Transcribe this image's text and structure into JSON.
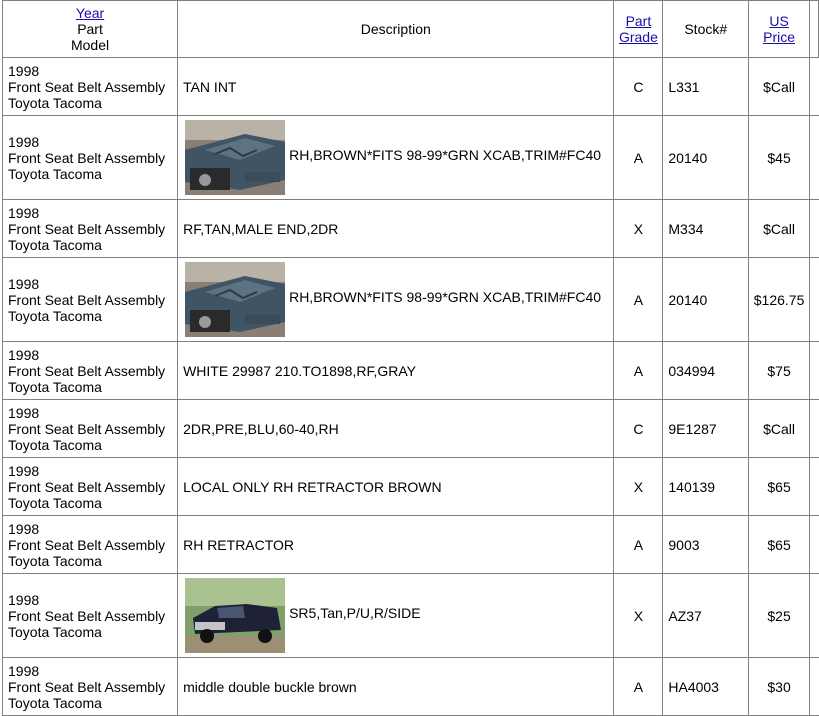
{
  "header": {
    "year_link": "Year",
    "part_label": "Part",
    "model_label": "Model",
    "description": "Description",
    "grade_link_1": "Part",
    "grade_link_2": "Grade",
    "stock": "Stock#",
    "price_link_1": "US",
    "price_link_2": "Price"
  },
  "rows": [
    {
      "year": "1998",
      "part": "Front Seat Belt Assembly",
      "model": "Toyota Tacoma",
      "description": "TAN INT",
      "image": "",
      "grade": "C",
      "stock": "L331",
      "price": "$Call"
    },
    {
      "year": "1998",
      "part": "Front Seat Belt Assembly",
      "model": "Toyota Tacoma",
      "description": "RH,BROWN*FITS 98-99*GRN XCAB,TRIM#FC40",
      "image": "damaged-truck-photo",
      "grade": "A",
      "stock": "20140",
      "price": "$45"
    },
    {
      "year": "1998",
      "part": "Front Seat Belt Assembly",
      "model": "Toyota Tacoma",
      "description": "RF,TAN,MALE END,2DR",
      "image": "",
      "grade": "X",
      "stock": "M334",
      "price": "$Call"
    },
    {
      "year": "1998",
      "part": "Front Seat Belt Assembly",
      "model": "Toyota Tacoma",
      "description": "RH,BROWN*FITS 98-99*GRN XCAB,TRIM#FC40",
      "image": "damaged-truck-photo",
      "grade": "A",
      "stock": "20140",
      "price": "$126.75"
    },
    {
      "year": "1998",
      "part": "Front Seat Belt Assembly",
      "model": "Toyota Tacoma",
      "description": "WHITE 29987 210.TO1898,RF,GRAY",
      "image": "",
      "grade": "A",
      "stock": "034994",
      "price": "$75"
    },
    {
      "year": "1998",
      "part": "Front Seat Belt Assembly",
      "model": "Toyota Tacoma",
      "description": "2DR,PRE,BLU,60-40,RH",
      "image": "",
      "grade": "C",
      "stock": "9E1287",
      "price": "$Call"
    },
    {
      "year": "1998",
      "part": "Front Seat Belt Assembly",
      "model": "Toyota Tacoma",
      "description": "LOCAL ONLY RH RETRACTOR BROWN",
      "image": "",
      "grade": "X",
      "stock": "140139",
      "price": "$65"
    },
    {
      "year": "1998",
      "part": "Front Seat Belt Assembly",
      "model": "Toyota Tacoma",
      "description": "RH RETRACTOR",
      "image": "",
      "grade": "A",
      "stock": "9003",
      "price": "$65"
    },
    {
      "year": "1998",
      "part": "Front Seat Belt Assembly",
      "model": "Toyota Tacoma",
      "description": "SR5,Tan,P/U,R/SIDE",
      "image": "pickup-truck-photo",
      "grade": "X",
      "stock": "AZ37",
      "price": "$25"
    },
    {
      "year": "1998",
      "part": "Front Seat Belt Assembly",
      "model": "Toyota Tacoma",
      "description": "middle double buckle brown",
      "image": "",
      "grade": "A",
      "stock": "HA4003",
      "price": "$30"
    }
  ],
  "colors": {
    "link": "#1a0dab",
    "border": "#808080",
    "damaged_truck_body": "#3f5566",
    "pickup_body": "#1f2236"
  }
}
